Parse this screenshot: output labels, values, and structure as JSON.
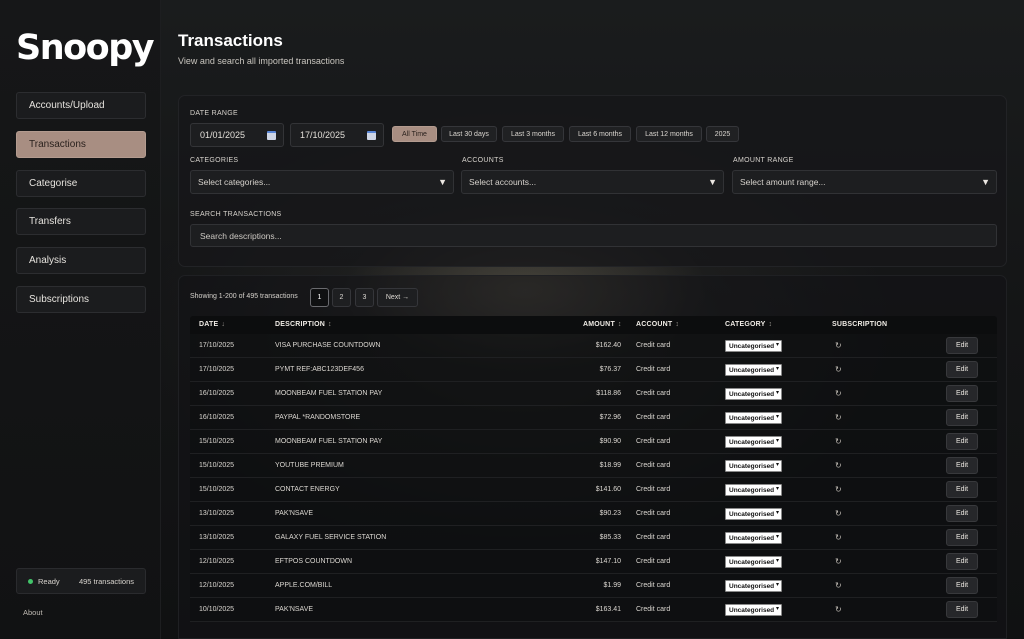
{
  "app": {
    "logo": "Snoopy"
  },
  "sidebar": {
    "items": [
      {
        "label": "Accounts/Upload",
        "active": false
      },
      {
        "label": "Transactions",
        "active": true
      },
      {
        "label": "Categorise",
        "active": false
      },
      {
        "label": "Transfers",
        "active": false
      },
      {
        "label": "Analysis",
        "active": false
      },
      {
        "label": "Subscriptions",
        "active": false
      }
    ],
    "status": {
      "state": "Ready",
      "count": "495 transactions"
    },
    "about": "About"
  },
  "header": {
    "title": "Transactions",
    "subtitle": "View and search all imported transactions"
  },
  "filters": {
    "date_range_label": "DATE RANGE",
    "date_from": "01/01/2025",
    "date_to": "17/10/2025",
    "presets": [
      "All Time",
      "Last 30 days",
      "Last 3 months",
      "Last 6 months",
      "Last 12 months",
      "2025"
    ],
    "active_preset": "All Time",
    "categories_label": "CATEGORIES",
    "categories_placeholder": "Select categories...",
    "accounts_label": "ACCOUNTS",
    "accounts_placeholder": "Select accounts...",
    "amount_label": "AMOUNT RANGE",
    "amount_placeholder": "Select amount range...",
    "search_label": "SEARCH TRANSACTIONS",
    "search_placeholder": "Search descriptions..."
  },
  "results": {
    "showing": "Showing 1-200 of 495 transactions",
    "pages": [
      "1",
      "2",
      "3"
    ],
    "current_page": "1",
    "next_label": "Next →",
    "columns": {
      "date": "DATE",
      "description": "DESCRIPTION",
      "amount": "AMOUNT",
      "account": "ACCOUNT",
      "category": "CATEGORY",
      "subscription": "SUBSCRIPTION"
    },
    "sort_glyph": "↕",
    "date_sort_glyph": "↓",
    "edit_label": "Edit",
    "rows": [
      {
        "date": "17/10/2025",
        "description": "VISA PURCHASE COUNTDOWN",
        "amount": "$162.40",
        "account": "Credit card",
        "category": "Uncategorised"
      },
      {
        "date": "17/10/2025",
        "description": "PYMT REF:ABC123DEF456",
        "amount": "$76.37",
        "account": "Credit card",
        "category": "Uncategorised"
      },
      {
        "date": "16/10/2025",
        "description": "MOONBEAM FUEL STATION PAY",
        "amount": "$118.86",
        "account": "Credit card",
        "category": "Uncategorised"
      },
      {
        "date": "16/10/2025",
        "description": "PAYPAL *RANDOMSTORE",
        "amount": "$72.96",
        "account": "Credit card",
        "category": "Uncategorised"
      },
      {
        "date": "15/10/2025",
        "description": "MOONBEAM FUEL STATION PAY",
        "amount": "$90.90",
        "account": "Credit card",
        "category": "Uncategorised"
      },
      {
        "date": "15/10/2025",
        "description": "YOUTUBE PREMIUM",
        "amount": "$18.99",
        "account": "Credit card",
        "category": "Uncategorised"
      },
      {
        "date": "15/10/2025",
        "description": "CONTACT ENERGY",
        "amount": "$141.60",
        "account": "Credit card",
        "category": "Uncategorised"
      },
      {
        "date": "13/10/2025",
        "description": "PAK'NSAVE",
        "amount": "$90.23",
        "account": "Credit card",
        "category": "Uncategorised"
      },
      {
        "date": "13/10/2025",
        "description": "GALAXY FUEL SERVICE STATION",
        "amount": "$85.33",
        "account": "Credit card",
        "category": "Uncategorised"
      },
      {
        "date": "12/10/2025",
        "description": "EFTPOS COUNTDOWN",
        "amount": "$147.10",
        "account": "Credit card",
        "category": "Uncategorised"
      },
      {
        "date": "12/10/2025",
        "description": "APPLE.COM/BILL",
        "amount": "$1.99",
        "account": "Credit card",
        "category": "Uncategorised"
      },
      {
        "date": "10/10/2025",
        "description": "PAK'NSAVE",
        "amount": "$163.41",
        "account": "Credit card",
        "category": "Uncategorised"
      }
    ]
  },
  "icons": {
    "calendar": "calendar-icon",
    "dropdown": "chevron-down-icon",
    "subscription": "refresh-icon"
  },
  "colors": {
    "accent": "#a88e82",
    "status_ok": "#42c46a"
  }
}
